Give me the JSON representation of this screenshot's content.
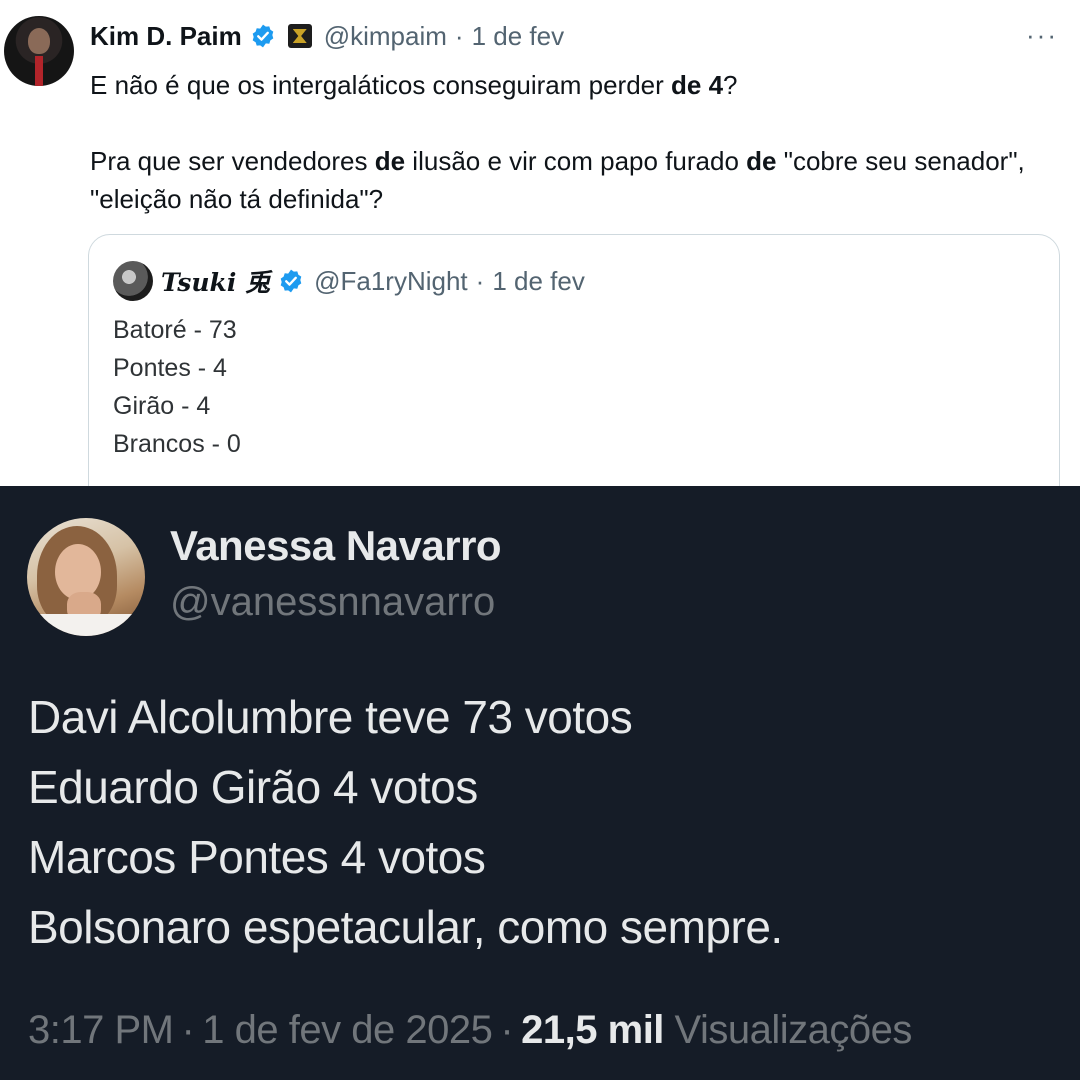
{
  "top_tweet": {
    "author_name": "Kim D. Paim",
    "handle": "@kimpaim",
    "separator": "·",
    "date": "1 de fev",
    "more_label": "···",
    "body": {
      "line1_a": "E não é que os intergaláticos conseguiram perder ",
      "line1_bold": "de 4",
      "line1_b": "?",
      "para2_a": "Pra que ser vendedores ",
      "para2_bold1": "de",
      "para2_b": " ilusão e vir com papo furado ",
      "para2_bold2": "de",
      "para2_c": " \"cobre seu senador\", \"eleição não tá definida\"?"
    },
    "quote": {
      "author_name": "Tsuki 兎",
      "handle": "@Fa1ryNight",
      "separator": "·",
      "date": "1 de fev",
      "lines": [
        "Batoré - 73",
        "Pontes - 4",
        "Girão - 4",
        "Brancos - 0"
      ]
    }
  },
  "bottom_tweet": {
    "author_name": "Vanessa Navarro",
    "handle": "@vanessnnavarro",
    "lines": [
      "Davi Alcolumbre teve 73 votos",
      "Eduardo Girão 4 votos",
      "Marcos Pontes 4 votos",
      "Bolsonaro espetacular, como sempre."
    ],
    "time": "3:17 PM",
    "separator": "·",
    "date": "1 de fev de 2025",
    "views_count": "21,5 mil",
    "views_label": "Visualizações"
  },
  "colors": {
    "verified_blue": "#1d9bf0",
    "dark_background": "#151c27",
    "muted_text": "#536471"
  },
  "icons": [
    "verified-badge-icon",
    "more-options-icon",
    "affiliate-badge-icon"
  ]
}
